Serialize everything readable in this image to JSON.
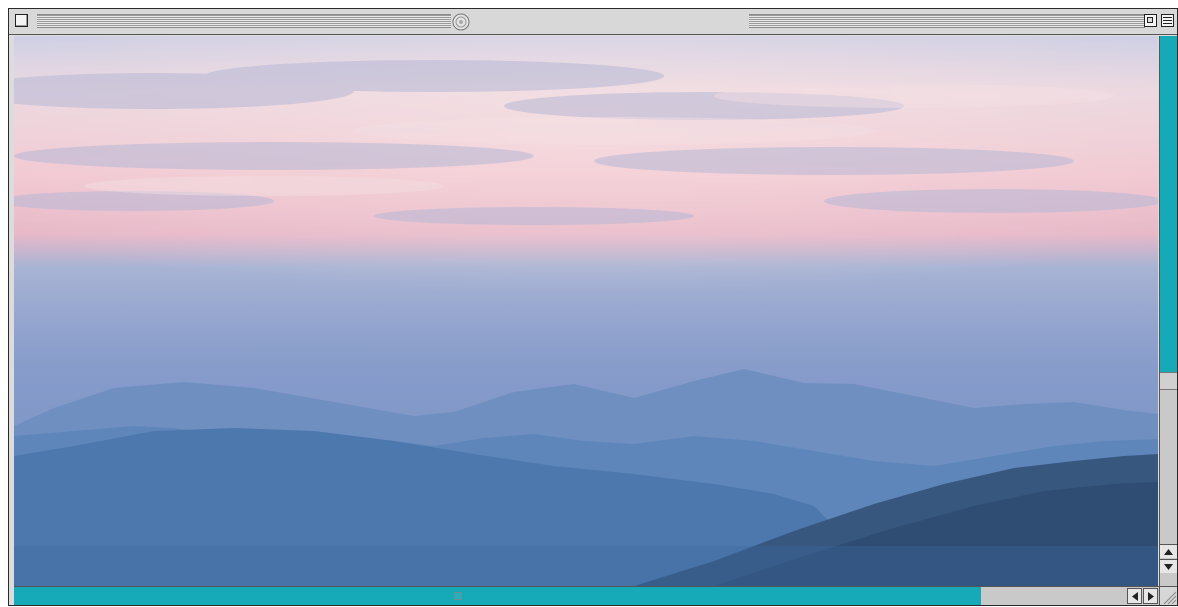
{
  "window": {
    "title": "",
    "controls": {
      "close_icon": "close-box-icon",
      "center_icon": "window-info-icon",
      "zoom_icon": "zoom-box-icon",
      "collapse_icon": "collapse-box-icon"
    }
  },
  "content": {
    "image_subject": "photo"
  },
  "scrollbars": {
    "vertical": {
      "position_fraction": 0.68,
      "accent": "#16aab8"
    },
    "horizontal": {
      "position_fraction": 0.87,
      "accent": "#16aab8"
    }
  },
  "colors": {
    "accent": "#16aab8",
    "chrome": "#d8d8d8",
    "border": "#2a2a2a"
  }
}
